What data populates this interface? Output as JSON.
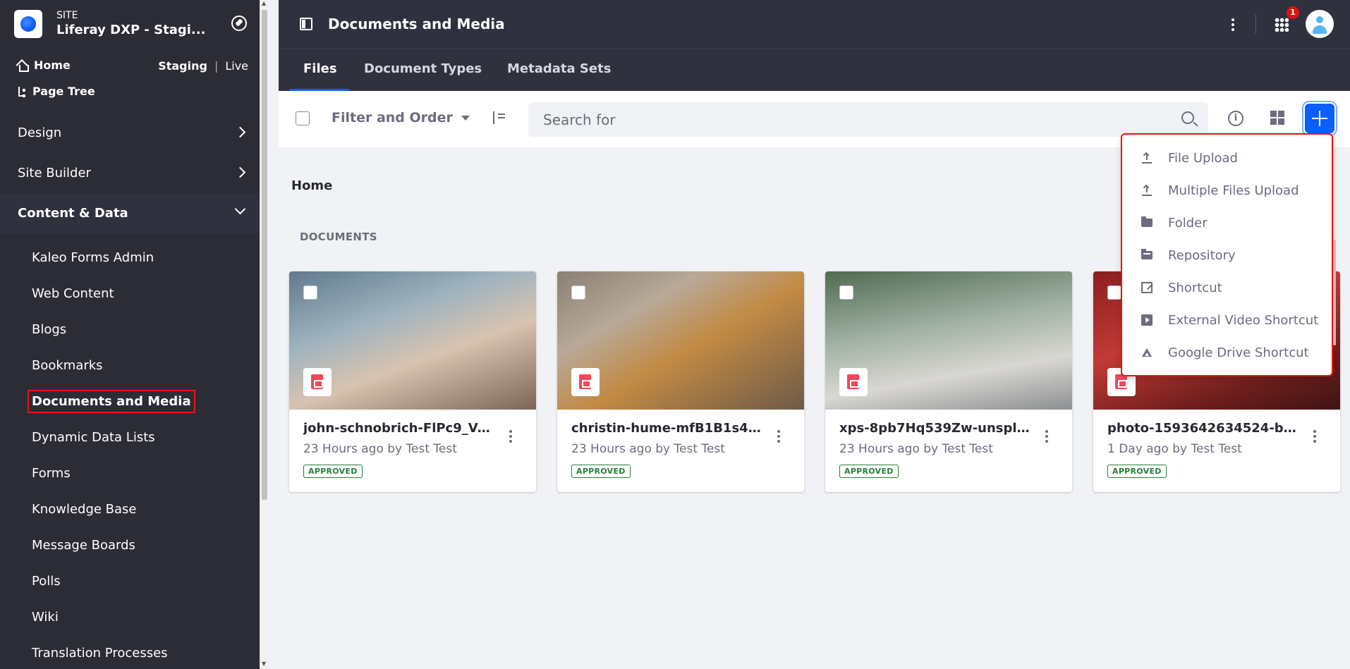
{
  "sidebar": {
    "site_kicker": "SITE",
    "site_name": "Liferay DXP - Stagi...",
    "home_label": "Home",
    "page_tree_label": "Page Tree",
    "staging_label": "Staging",
    "staging_separator": "|",
    "live_label": "Live",
    "sections": [
      {
        "label": "Design",
        "icon": "chevron-right-icon"
      },
      {
        "label": "Site Builder",
        "icon": "chevron-right-icon"
      },
      {
        "label": "Content & Data",
        "icon": "chevron-down-icon"
      }
    ],
    "items": [
      {
        "label": "Kaleo Forms Admin"
      },
      {
        "label": "Web Content"
      },
      {
        "label": "Blogs"
      },
      {
        "label": "Bookmarks"
      },
      {
        "label": "Documents and Media"
      },
      {
        "label": "Dynamic Data Lists"
      },
      {
        "label": "Forms"
      },
      {
        "label": "Knowledge Base"
      },
      {
        "label": "Message Boards"
      },
      {
        "label": "Polls"
      },
      {
        "label": "Wiki"
      },
      {
        "label": "Translation Processes"
      }
    ]
  },
  "header": {
    "title": "Documents and Media",
    "notification_count": "1"
  },
  "tabs": [
    {
      "label": "Files"
    },
    {
      "label": "Document Types"
    },
    {
      "label": "Metadata Sets"
    }
  ],
  "toolbar": {
    "filter_label": "Filter and Order",
    "search_placeholder": "Search for",
    "accent_color": "#0b5fff"
  },
  "content": {
    "breadcrumb": "Home",
    "section_label": "DOCUMENTS",
    "cards": [
      {
        "title": "john-schnobrich-FlPc9_Vo...",
        "meta": "23 Hours ago by Test Test",
        "status": "APPROVED"
      },
      {
        "title": "christin-hume-mfB1B1s4...",
        "meta": "23 Hours ago by Test Test",
        "status": "APPROVED"
      },
      {
        "title": "xps-8pb7Hq539Zw-unspl...",
        "meta": "23 Hours ago by Test Test",
        "status": "APPROVED"
      },
      {
        "title": "photo-1593642634524-b...",
        "meta": "1 Day ago by Test Test",
        "status": "APPROVED"
      }
    ]
  },
  "add_menu": {
    "items": [
      {
        "label": "File Upload",
        "icon": "upload-icon"
      },
      {
        "label": "Multiple Files Upload",
        "icon": "multiple-upload-icon"
      },
      {
        "label": "Folder",
        "icon": "folder-icon"
      },
      {
        "label": "Repository",
        "icon": "repository-icon"
      },
      {
        "label": "Shortcut",
        "icon": "shortcut-icon"
      },
      {
        "label": "External Video Shortcut",
        "icon": "video-icon"
      },
      {
        "label": "Google Drive Shortcut",
        "icon": "google-drive-icon"
      }
    ]
  }
}
